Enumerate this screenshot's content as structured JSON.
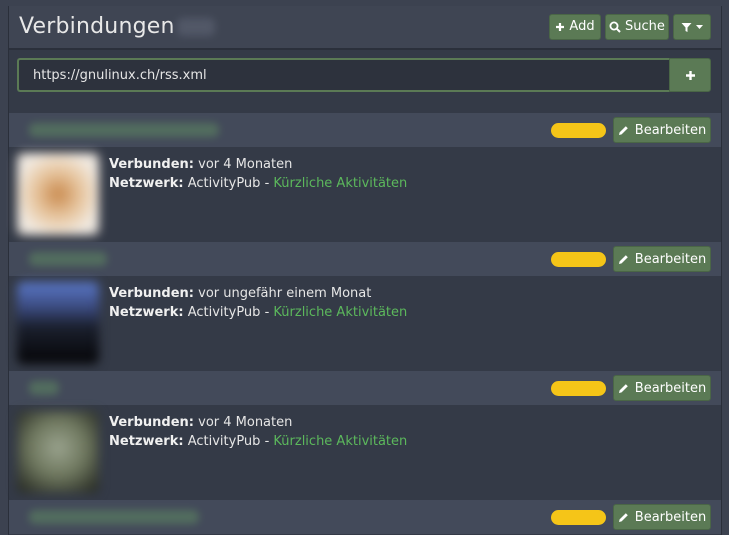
{
  "header": {
    "title": "Verbindungen",
    "add_label": "Add",
    "search_label": "Suche"
  },
  "url_input": {
    "value": "https://gnulinux.ch/rss.xml"
  },
  "labels": {
    "connected": "Verbunden:",
    "network": "Netzwerk:",
    "separator": "-",
    "edit": "Bearbeiten"
  },
  "entries": [
    {
      "connected": "vor 4 Monaten",
      "network": "ActivityPub",
      "recent": "Kürzliche Aktivitäten"
    },
    {
      "connected": "vor ungefähr einem Monat",
      "network": "ActivityPub",
      "recent": "Kürzliche Aktivitäten"
    },
    {
      "connected": "vor 4 Monaten",
      "network": "ActivityPub",
      "recent": "Kürzliche Aktivitäten"
    },
    {
      "connected": "",
      "network": "",
      "recent": ""
    }
  ],
  "colors": {
    "accent": "#5b7a55",
    "link": "#5cb85c",
    "badge": "#f5c518",
    "background": "#343a47"
  },
  "icons": {
    "add": "plus-icon",
    "search": "search-icon",
    "filter": "filter-icon",
    "edit": "pencil-icon"
  }
}
